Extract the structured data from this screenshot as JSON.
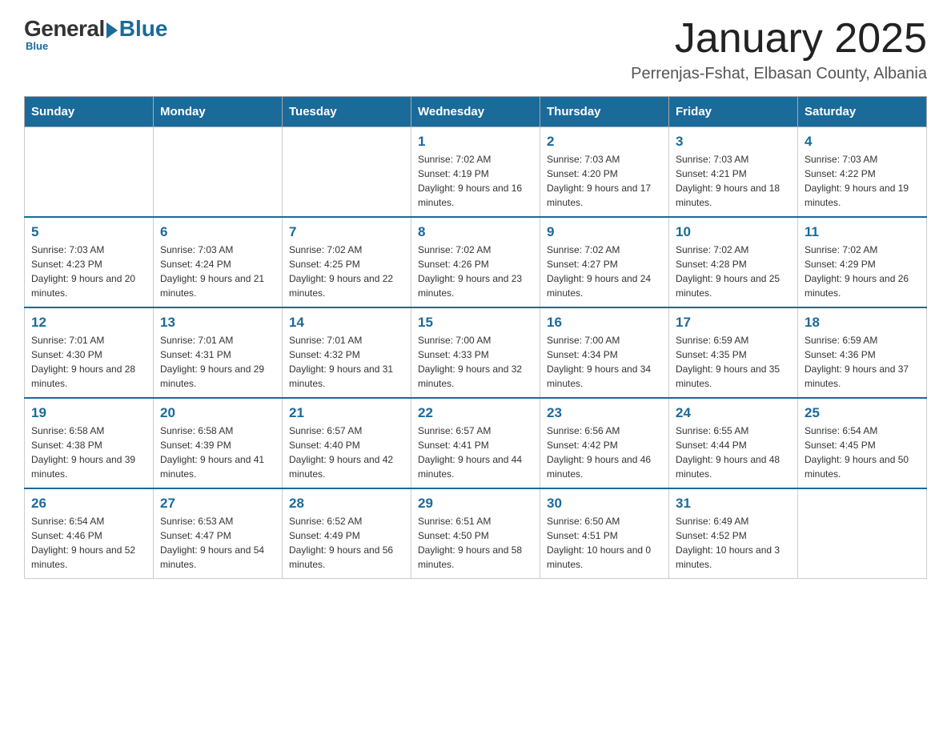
{
  "header": {
    "logo": {
      "general": "General",
      "blue": "Blue"
    },
    "title": "January 2025",
    "location": "Perrenjas-Fshat, Elbasan County, Albania"
  },
  "days_of_week": [
    "Sunday",
    "Monday",
    "Tuesday",
    "Wednesday",
    "Thursday",
    "Friday",
    "Saturday"
  ],
  "weeks": [
    [
      {
        "day": "",
        "info": ""
      },
      {
        "day": "",
        "info": ""
      },
      {
        "day": "",
        "info": ""
      },
      {
        "day": "1",
        "info": "Sunrise: 7:02 AM\nSunset: 4:19 PM\nDaylight: 9 hours and 16 minutes."
      },
      {
        "day": "2",
        "info": "Sunrise: 7:03 AM\nSunset: 4:20 PM\nDaylight: 9 hours and 17 minutes."
      },
      {
        "day": "3",
        "info": "Sunrise: 7:03 AM\nSunset: 4:21 PM\nDaylight: 9 hours and 18 minutes."
      },
      {
        "day": "4",
        "info": "Sunrise: 7:03 AM\nSunset: 4:22 PM\nDaylight: 9 hours and 19 minutes."
      }
    ],
    [
      {
        "day": "5",
        "info": "Sunrise: 7:03 AM\nSunset: 4:23 PM\nDaylight: 9 hours and 20 minutes."
      },
      {
        "day": "6",
        "info": "Sunrise: 7:03 AM\nSunset: 4:24 PM\nDaylight: 9 hours and 21 minutes."
      },
      {
        "day": "7",
        "info": "Sunrise: 7:02 AM\nSunset: 4:25 PM\nDaylight: 9 hours and 22 minutes."
      },
      {
        "day": "8",
        "info": "Sunrise: 7:02 AM\nSunset: 4:26 PM\nDaylight: 9 hours and 23 minutes."
      },
      {
        "day": "9",
        "info": "Sunrise: 7:02 AM\nSunset: 4:27 PM\nDaylight: 9 hours and 24 minutes."
      },
      {
        "day": "10",
        "info": "Sunrise: 7:02 AM\nSunset: 4:28 PM\nDaylight: 9 hours and 25 minutes."
      },
      {
        "day": "11",
        "info": "Sunrise: 7:02 AM\nSunset: 4:29 PM\nDaylight: 9 hours and 26 minutes."
      }
    ],
    [
      {
        "day": "12",
        "info": "Sunrise: 7:01 AM\nSunset: 4:30 PM\nDaylight: 9 hours and 28 minutes."
      },
      {
        "day": "13",
        "info": "Sunrise: 7:01 AM\nSunset: 4:31 PM\nDaylight: 9 hours and 29 minutes."
      },
      {
        "day": "14",
        "info": "Sunrise: 7:01 AM\nSunset: 4:32 PM\nDaylight: 9 hours and 31 minutes."
      },
      {
        "day": "15",
        "info": "Sunrise: 7:00 AM\nSunset: 4:33 PM\nDaylight: 9 hours and 32 minutes."
      },
      {
        "day": "16",
        "info": "Sunrise: 7:00 AM\nSunset: 4:34 PM\nDaylight: 9 hours and 34 minutes."
      },
      {
        "day": "17",
        "info": "Sunrise: 6:59 AM\nSunset: 4:35 PM\nDaylight: 9 hours and 35 minutes."
      },
      {
        "day": "18",
        "info": "Sunrise: 6:59 AM\nSunset: 4:36 PM\nDaylight: 9 hours and 37 minutes."
      }
    ],
    [
      {
        "day": "19",
        "info": "Sunrise: 6:58 AM\nSunset: 4:38 PM\nDaylight: 9 hours and 39 minutes."
      },
      {
        "day": "20",
        "info": "Sunrise: 6:58 AM\nSunset: 4:39 PM\nDaylight: 9 hours and 41 minutes."
      },
      {
        "day": "21",
        "info": "Sunrise: 6:57 AM\nSunset: 4:40 PM\nDaylight: 9 hours and 42 minutes."
      },
      {
        "day": "22",
        "info": "Sunrise: 6:57 AM\nSunset: 4:41 PM\nDaylight: 9 hours and 44 minutes."
      },
      {
        "day": "23",
        "info": "Sunrise: 6:56 AM\nSunset: 4:42 PM\nDaylight: 9 hours and 46 minutes."
      },
      {
        "day": "24",
        "info": "Sunrise: 6:55 AM\nSunset: 4:44 PM\nDaylight: 9 hours and 48 minutes."
      },
      {
        "day": "25",
        "info": "Sunrise: 6:54 AM\nSunset: 4:45 PM\nDaylight: 9 hours and 50 minutes."
      }
    ],
    [
      {
        "day": "26",
        "info": "Sunrise: 6:54 AM\nSunset: 4:46 PM\nDaylight: 9 hours and 52 minutes."
      },
      {
        "day": "27",
        "info": "Sunrise: 6:53 AM\nSunset: 4:47 PM\nDaylight: 9 hours and 54 minutes."
      },
      {
        "day": "28",
        "info": "Sunrise: 6:52 AM\nSunset: 4:49 PM\nDaylight: 9 hours and 56 minutes."
      },
      {
        "day": "29",
        "info": "Sunrise: 6:51 AM\nSunset: 4:50 PM\nDaylight: 9 hours and 58 minutes."
      },
      {
        "day": "30",
        "info": "Sunrise: 6:50 AM\nSunset: 4:51 PM\nDaylight: 10 hours and 0 minutes."
      },
      {
        "day": "31",
        "info": "Sunrise: 6:49 AM\nSunset: 4:52 PM\nDaylight: 10 hours and 3 minutes."
      },
      {
        "day": "",
        "info": ""
      }
    ]
  ]
}
